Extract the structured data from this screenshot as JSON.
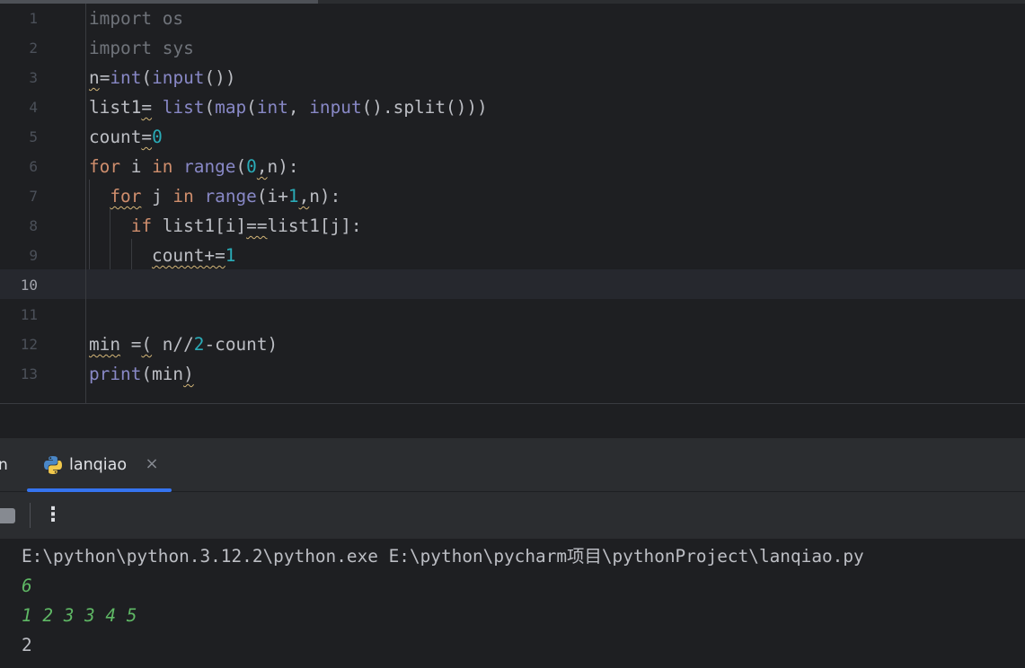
{
  "editor": {
    "current_line": 10,
    "lines": [
      {
        "num": "1",
        "tokens": [
          {
            "t": "import",
            "c": "dim"
          },
          {
            "t": " os",
            "c": "dim"
          }
        ]
      },
      {
        "num": "2",
        "tokens": [
          {
            "t": "import",
            "c": "dim"
          },
          {
            "t": " sys",
            "c": "dim"
          }
        ]
      },
      {
        "num": "3",
        "tokens": [
          {
            "t": "n",
            "c": "wavy"
          },
          {
            "t": "=",
            "c": ""
          },
          {
            "t": "int",
            "c": "bi"
          },
          {
            "t": "(",
            "c": ""
          },
          {
            "t": "input",
            "c": "bi"
          },
          {
            "t": "())",
            "c": ""
          }
        ]
      },
      {
        "num": "4",
        "tokens": [
          {
            "t": "list1",
            "c": ""
          },
          {
            "t": "=",
            "c": "wavy"
          },
          {
            "t": " ",
            "c": ""
          },
          {
            "t": "list",
            "c": "bi"
          },
          {
            "t": "(",
            "c": ""
          },
          {
            "t": "map",
            "c": "bi"
          },
          {
            "t": "(",
            "c": ""
          },
          {
            "t": "int",
            "c": "bi"
          },
          {
            "t": ", ",
            "c": ""
          },
          {
            "t": "input",
            "c": "bi"
          },
          {
            "t": "().split()))",
            "c": ""
          }
        ]
      },
      {
        "num": "5",
        "tokens": [
          {
            "t": "count",
            "c": ""
          },
          {
            "t": "=",
            "c": "wavy"
          },
          {
            "t": "0",
            "c": "num"
          }
        ]
      },
      {
        "num": "6",
        "tokens": [
          {
            "t": "for",
            "c": "kw"
          },
          {
            "t": " i ",
            "c": ""
          },
          {
            "t": "in",
            "c": "kw"
          },
          {
            "t": " ",
            "c": ""
          },
          {
            "t": "range",
            "c": "bi"
          },
          {
            "t": "(",
            "c": ""
          },
          {
            "t": "0",
            "c": "num"
          },
          {
            "t": ",",
            "c": "wavy"
          },
          {
            "t": "n):",
            "c": ""
          }
        ]
      },
      {
        "num": "7",
        "tokens": [
          {
            "t": "  ",
            "c": ""
          },
          {
            "t": "for",
            "c": "kw wavy"
          },
          {
            "t": " j ",
            "c": ""
          },
          {
            "t": "in",
            "c": "kw"
          },
          {
            "t": " ",
            "c": ""
          },
          {
            "t": "range",
            "c": "bi"
          },
          {
            "t": "(i+",
            "c": ""
          },
          {
            "t": "1",
            "c": "num"
          },
          {
            "t": ",",
            "c": "wavy"
          },
          {
            "t": "n):",
            "c": ""
          }
        ]
      },
      {
        "num": "8",
        "tokens": [
          {
            "t": "    ",
            "c": ""
          },
          {
            "t": "if",
            "c": "kw"
          },
          {
            "t": " list1[i]",
            "c": ""
          },
          {
            "t": "==",
            "c": "wavy"
          },
          {
            "t": "list1[j]:",
            "c": ""
          }
        ]
      },
      {
        "num": "9",
        "tokens": [
          {
            "t": "      ",
            "c": ""
          },
          {
            "t": "count+=",
            "c": "wavy"
          },
          {
            "t": "1",
            "c": "num"
          }
        ]
      },
      {
        "num": "10",
        "tokens": []
      },
      {
        "num": "11",
        "tokens": []
      },
      {
        "num": "12",
        "tokens": [
          {
            "t": "min",
            "c": "wavy"
          },
          {
            "t": " =",
            "c": ""
          },
          {
            "t": "(",
            "c": "wavy"
          },
          {
            "t": " n//",
            "c": ""
          },
          {
            "t": "2",
            "c": "num"
          },
          {
            "t": "-count)",
            "c": ""
          }
        ]
      },
      {
        "num": "13",
        "tokens": [
          {
            "t": "print",
            "c": "bi"
          },
          {
            "t": "(min",
            "c": ""
          },
          {
            "t": ")",
            "c": "wavy"
          }
        ]
      }
    ]
  },
  "run_panel": {
    "partial_tab_label": "n",
    "active_tab_label": "lanqiao",
    "tab_icon": "python-icon",
    "close_icon": "close-icon",
    "toolbar_icons": [
      "stop-icon",
      "more-vertical-icon"
    ],
    "more_glyph": "⋮",
    "close_glyph": "×"
  },
  "console": {
    "command": "E:\\python\\python.3.12.2\\python.exe E:\\python\\pycharm项目\\pythonProject\\lanqiao.py",
    "input_lines": [
      "6",
      "1 2 3 3 4 5"
    ],
    "output": "2"
  },
  "colors": {
    "background": "#1e1f22",
    "panel": "#2b2d30",
    "keyword": "#cf8e6d",
    "builtin": "#8888c6",
    "number": "#2aacb8",
    "console_input": "#5fb865",
    "accent": "#3574f0"
  }
}
